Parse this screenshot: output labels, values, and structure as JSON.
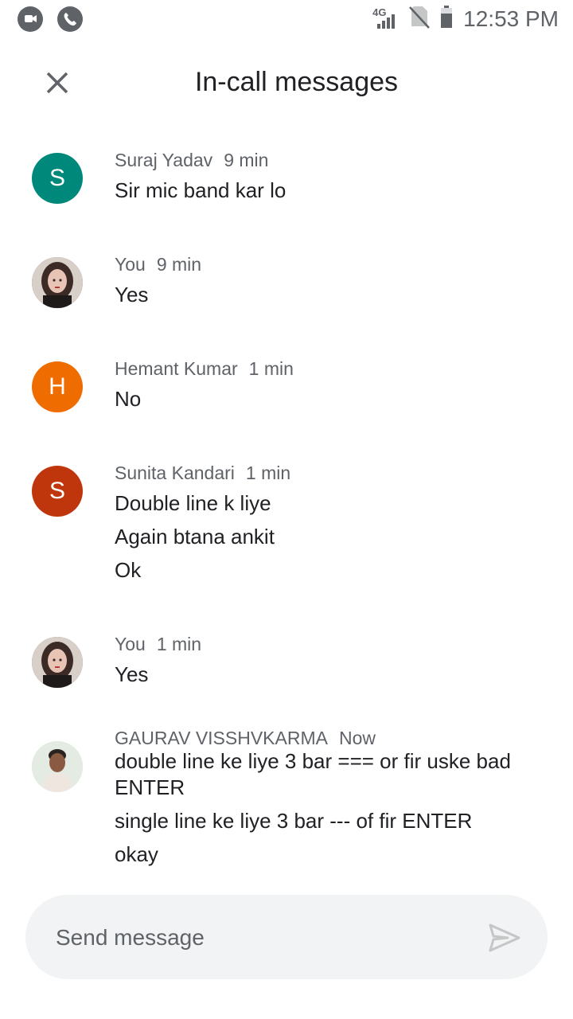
{
  "status_bar": {
    "time": "12:53 PM",
    "network": "4G",
    "left_icons": [
      "chat-bubble-icon",
      "phone-icon"
    ]
  },
  "header": {
    "title": "In-call messages",
    "close_icon": "close-icon"
  },
  "messages": [
    {
      "sender": "Suraj Yadav",
      "time": "9 min",
      "avatar_letter": "S",
      "avatar_color": "#00897b",
      "lines": [
        "Sir mic band kar lo"
      ]
    },
    {
      "sender": "You",
      "time": "9 min",
      "avatar_photo": true,
      "lines": [
        "Yes"
      ]
    },
    {
      "sender": "Hemant Kumar",
      "time": "1 min",
      "avatar_letter": "H",
      "avatar_color": "#ef6c00",
      "lines": [
        "No"
      ]
    },
    {
      "sender": "Sunita Kandari",
      "time": "1 min",
      "avatar_letter": "S",
      "avatar_color": "#bf360c",
      "lines": [
        "Double line k liye",
        "Again btana ankit",
        "Ok"
      ]
    },
    {
      "sender": "You",
      "time": "1 min",
      "avatar_photo": true,
      "lines": [
        "Yes"
      ]
    },
    {
      "sender": "GAURAV VISSHVKARMA",
      "time": "Now",
      "avatar_photo": true,
      "lines": [
        "double line ke liye 3 bar === or fir uske bad ENTER",
        "single line ke liye 3 bar --- of fir ENTER",
        "okay"
      ]
    }
  ],
  "composer": {
    "placeholder": "Send message",
    "send_icon": "send-icon"
  }
}
